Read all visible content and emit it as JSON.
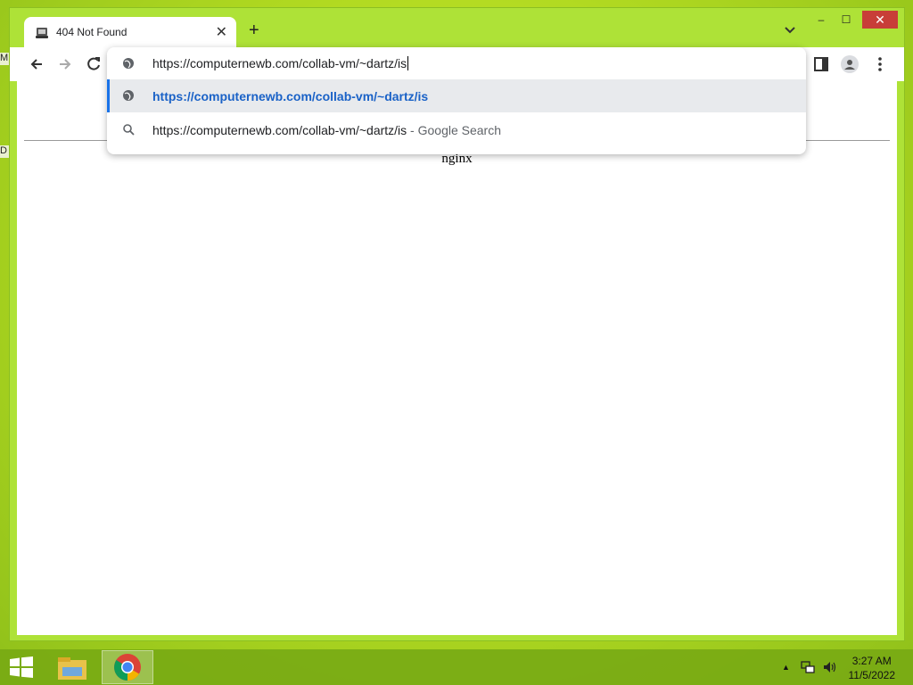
{
  "desktop": {
    "edge_label_1": "M",
    "edge_label_2": "D"
  },
  "tab": {
    "title": "404 Not Found",
    "close_glyph": "✕"
  },
  "tabstrip": {
    "new_tab_glyph": "+"
  },
  "window_controls": {
    "minimize": "–",
    "maximize": "☐",
    "close": "✕"
  },
  "omnibox": {
    "input_value": "https://computernewb.com/collab-vm/~dartz/is",
    "suggestions": [
      {
        "icon": "globe-icon",
        "text": "https://computernewb.com/collab-vm/~dartz/is",
        "suffix": ""
      },
      {
        "icon": "search-icon",
        "text": "https://computernewb.com/collab-vm/~dartz/is",
        "suffix": " - Google Search"
      }
    ]
  },
  "page": {
    "server_text": "nginx"
  },
  "taskbar": {
    "time": "3:27 AM",
    "date": "11/5/2022",
    "tray_arrow": "▲"
  },
  "colors": {
    "accent": "#1a73e8",
    "selected_row": "#e8eaed",
    "close_red": "#c83e38",
    "desktop_green": "#b5dc22"
  }
}
